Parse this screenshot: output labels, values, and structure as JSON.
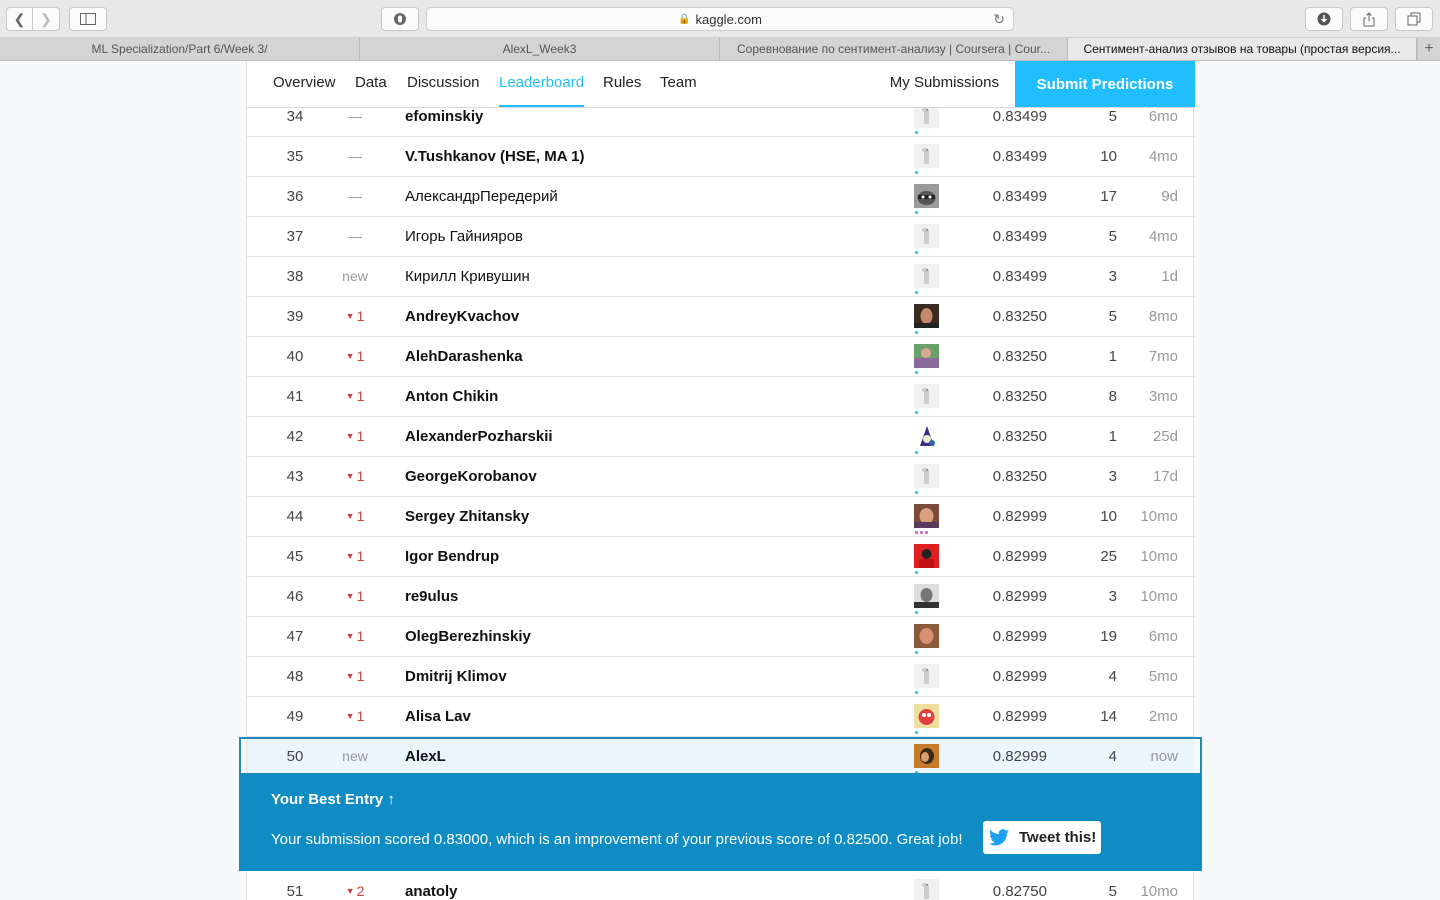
{
  "browser": {
    "url": "kaggle.com",
    "tabs": [
      {
        "label": "ML Specialization/Part 6/Week 3/",
        "active": false
      },
      {
        "label": "AlexL_Week3",
        "active": false
      },
      {
        "label": "Соревнование по сентимент-анализу | Coursera | Cour...",
        "active": false
      },
      {
        "label": "Сентимент-анализ отзывов на товары (простая версия...",
        "active": true
      }
    ]
  },
  "subnav": {
    "overview": "Overview",
    "data": "Data",
    "discussion": "Discussion",
    "leaderboard": "Leaderboard",
    "rules": "Rules",
    "team": "Team",
    "my_submissions": "My Submissions",
    "submit": "Submit Predictions"
  },
  "leaderboard": {
    "rows": [
      {
        "rank": "34",
        "change": "—",
        "dir": "none",
        "name": "efominskiy",
        "bold": true,
        "avatar": "default",
        "score": "0.83499",
        "entries": "5",
        "last": "6mo"
      },
      {
        "rank": "35",
        "change": "—",
        "dir": "none",
        "name": "V.Tushkanov (HSE, MA 1)",
        "bold": true,
        "avatar": "default",
        "score": "0.83499",
        "entries": "10",
        "last": "4mo"
      },
      {
        "rank": "36",
        "change": "—",
        "dir": "none",
        "name": "АлександрПередерий",
        "bold": false,
        "avatar": "raccoon",
        "score": "0.83499",
        "entries": "17",
        "last": "9d"
      },
      {
        "rank": "37",
        "change": "—",
        "dir": "none",
        "name": "Игорь Гайнияров",
        "bold": false,
        "avatar": "default",
        "score": "0.83499",
        "entries": "5",
        "last": "4mo"
      },
      {
        "rank": "38",
        "change": "new",
        "dir": "new",
        "name": "Кирилл Кривушин",
        "bold": false,
        "avatar": "default",
        "score": "0.83499",
        "entries": "3",
        "last": "1d"
      },
      {
        "rank": "39",
        "change": "1",
        "dir": "down",
        "name": "AndreyKvachov",
        "bold": true,
        "avatar": "photo-face",
        "score": "0.83250",
        "entries": "5",
        "last": "8mo"
      },
      {
        "rank": "40",
        "change": "1",
        "dir": "down",
        "name": "AlehDarashenka",
        "bold": true,
        "avatar": "photo-outdoor",
        "score": "0.83250",
        "entries": "1",
        "last": "7mo"
      },
      {
        "rank": "41",
        "change": "1",
        "dir": "down",
        "name": "Anton Chikin",
        "bold": true,
        "avatar": "default",
        "score": "0.83250",
        "entries": "8",
        "last": "3mo"
      },
      {
        "rank": "42",
        "change": "1",
        "dir": "down",
        "name": "AlexanderPozharskii",
        "bold": true,
        "avatar": "wizard",
        "score": "0.83250",
        "entries": "1",
        "last": "25d"
      },
      {
        "rank": "43",
        "change": "1",
        "dir": "down",
        "name": "GeorgeKorobanov",
        "bold": true,
        "avatar": "default",
        "score": "0.83250",
        "entries": "3",
        "last": "17d"
      },
      {
        "rank": "44",
        "change": "1",
        "dir": "down",
        "name": "Sergey Zhitansky",
        "bold": true,
        "avatar": "photo-warm",
        "score": "0.82999",
        "entries": "10",
        "last": "10mo",
        "tier": "p3"
      },
      {
        "rank": "45",
        "change": "1",
        "dir": "down",
        "name": "Igor Bendrup",
        "bold": true,
        "avatar": "photo-red",
        "score": "0.82999",
        "entries": "25",
        "last": "10mo"
      },
      {
        "rank": "46",
        "change": "1",
        "dir": "down",
        "name": "re9ulus",
        "bold": true,
        "avatar": "photo-bw",
        "score": "0.82999",
        "entries": "3",
        "last": "10mo"
      },
      {
        "rank": "47",
        "change": "1",
        "dir": "down",
        "name": "OlegBerezhinskiy",
        "bold": true,
        "avatar": "photo-brown",
        "score": "0.82999",
        "entries": "19",
        "last": "6mo"
      },
      {
        "rank": "48",
        "change": "1",
        "dir": "down",
        "name": "Dmitrij Klimov",
        "bold": true,
        "avatar": "default",
        "score": "0.82999",
        "entries": "4",
        "last": "5mo"
      },
      {
        "rank": "49",
        "change": "1",
        "dir": "down",
        "name": "Alisa Lav",
        "bold": true,
        "avatar": "photo-cartoon",
        "score": "0.82999",
        "entries": "14",
        "last": "2mo"
      },
      {
        "rank": "50",
        "change": "new",
        "dir": "new",
        "name": "AlexL",
        "bold": true,
        "avatar": "photo-me",
        "score": "0.82999",
        "entries": "4",
        "last": "now",
        "me": true
      }
    ],
    "after_banner": [
      {
        "rank": "51",
        "change": "2",
        "dir": "down",
        "name": "anatoly",
        "bold": true,
        "avatar": "default",
        "score": "0.82750",
        "entries": "5",
        "last": "10mo"
      }
    ]
  },
  "banner": {
    "title": "Your Best Entry ↑",
    "message": "Your submission scored 0.83000, which is an improvement of your previous score of 0.82500. Great job!",
    "tweet": "Tweet this!"
  },
  "colors": {
    "accent": "#20beff",
    "banner": "#0f8cc4",
    "down": "#cc3d3d"
  }
}
